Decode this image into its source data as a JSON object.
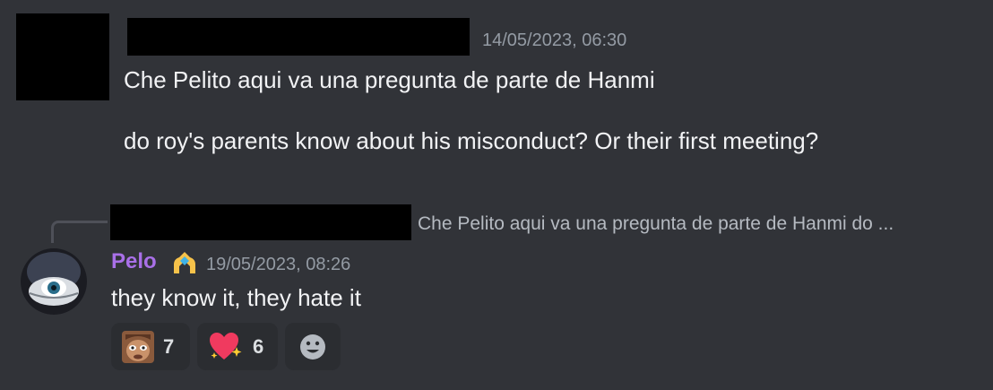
{
  "message1": {
    "timestamp": "14/05/2023, 06:30",
    "text": "Che Pelito aqui va una pregunta de parte de Hanmi\n\ndo roy's parents know about his misconduct? Or their first meeting?"
  },
  "reply": {
    "preview": "Che Pelito aqui va una pregunta de parte de Hanmi   do ..."
  },
  "message2": {
    "username": "Pelo",
    "username_color": "#a970e8",
    "badge_icon": "hands-heart-icon",
    "timestamp": "19/05/2023, 08:26",
    "text": "they know it, they hate it"
  },
  "reactions": [
    {
      "emoji": "custom-face-emoji",
      "count": "7"
    },
    {
      "emoji": "sparkling-heart-emoji",
      "count": "6"
    }
  ],
  "add_reaction": {
    "icon": "smile-add-reaction-icon"
  }
}
